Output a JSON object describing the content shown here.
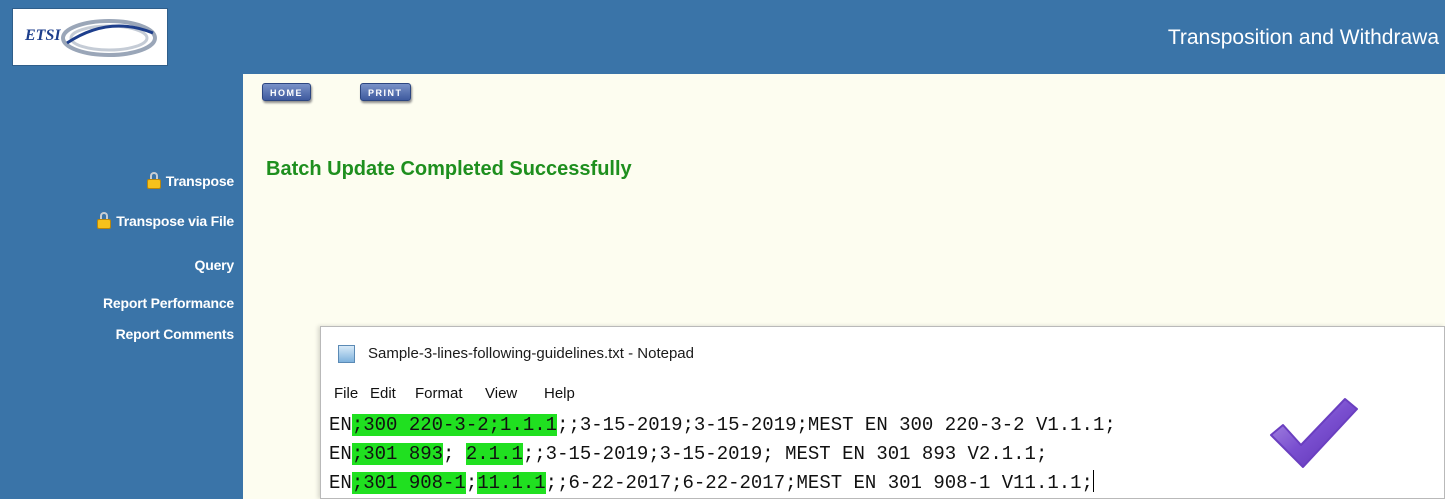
{
  "header": {
    "logo_text": "ETSI",
    "title": "Transposition and Withdrawa"
  },
  "sidebar": {
    "items": [
      {
        "label": "Transpose",
        "icon": "lock-icon"
      },
      {
        "label": "Transpose via File",
        "icon": "lock-icon"
      },
      {
        "label": "Query"
      },
      {
        "label": "Report Performance"
      },
      {
        "label": "Report Comments"
      }
    ]
  },
  "toolbar": {
    "home_label": "HOME",
    "print_label": "PRINT"
  },
  "main": {
    "status_message": "Batch Update Completed Successfully"
  },
  "notepad": {
    "title": "Sample-3-lines-following-guidelines.txt - Notepad",
    "menu": [
      "File",
      "Edit",
      "Format",
      "View",
      "Help"
    ],
    "lines": [
      {
        "segments": [
          {
            "text": "EN",
            "hl": false
          },
          {
            "text": ";300 220-3-2;",
            "hl": true
          },
          {
            "text": "1.1.1",
            "hl": true
          },
          {
            "text": ";;3-15-2019;3-15-2019;MEST EN 300 220-3-2 V1.1.1;",
            "hl": false
          }
        ]
      },
      {
        "segments": [
          {
            "text": "EN",
            "hl": false
          },
          {
            "text": ";301 893",
            "hl": true
          },
          {
            "text": "; ",
            "hl": false
          },
          {
            "text": "2.1.1",
            "hl": true
          },
          {
            "text": ";;3-15-2019;3-15-2019; MEST EN 301 893 V2.1.1;",
            "hl": false
          }
        ]
      },
      {
        "segments": [
          {
            "text": "EN",
            "hl": false
          },
          {
            "text": ";301 908-1",
            "hl": true
          },
          {
            "text": ";",
            "hl": false
          },
          {
            "text": "11.1.1",
            "hl": true
          },
          {
            "text": ";;6-22-2017;6-22-2017;MEST EN 301 908-1 V11.1.1;",
            "hl": false
          }
        ]
      }
    ]
  },
  "colors": {
    "brand_blue": "#3a74a8",
    "success_green": "#1e8f1e",
    "highlight_green": "#20e020",
    "check_purple": "#6a3fc0"
  },
  "icons": {
    "checkmark": "checkmark-icon",
    "notepad": "notepad-icon",
    "logo": "etsi-logo"
  }
}
